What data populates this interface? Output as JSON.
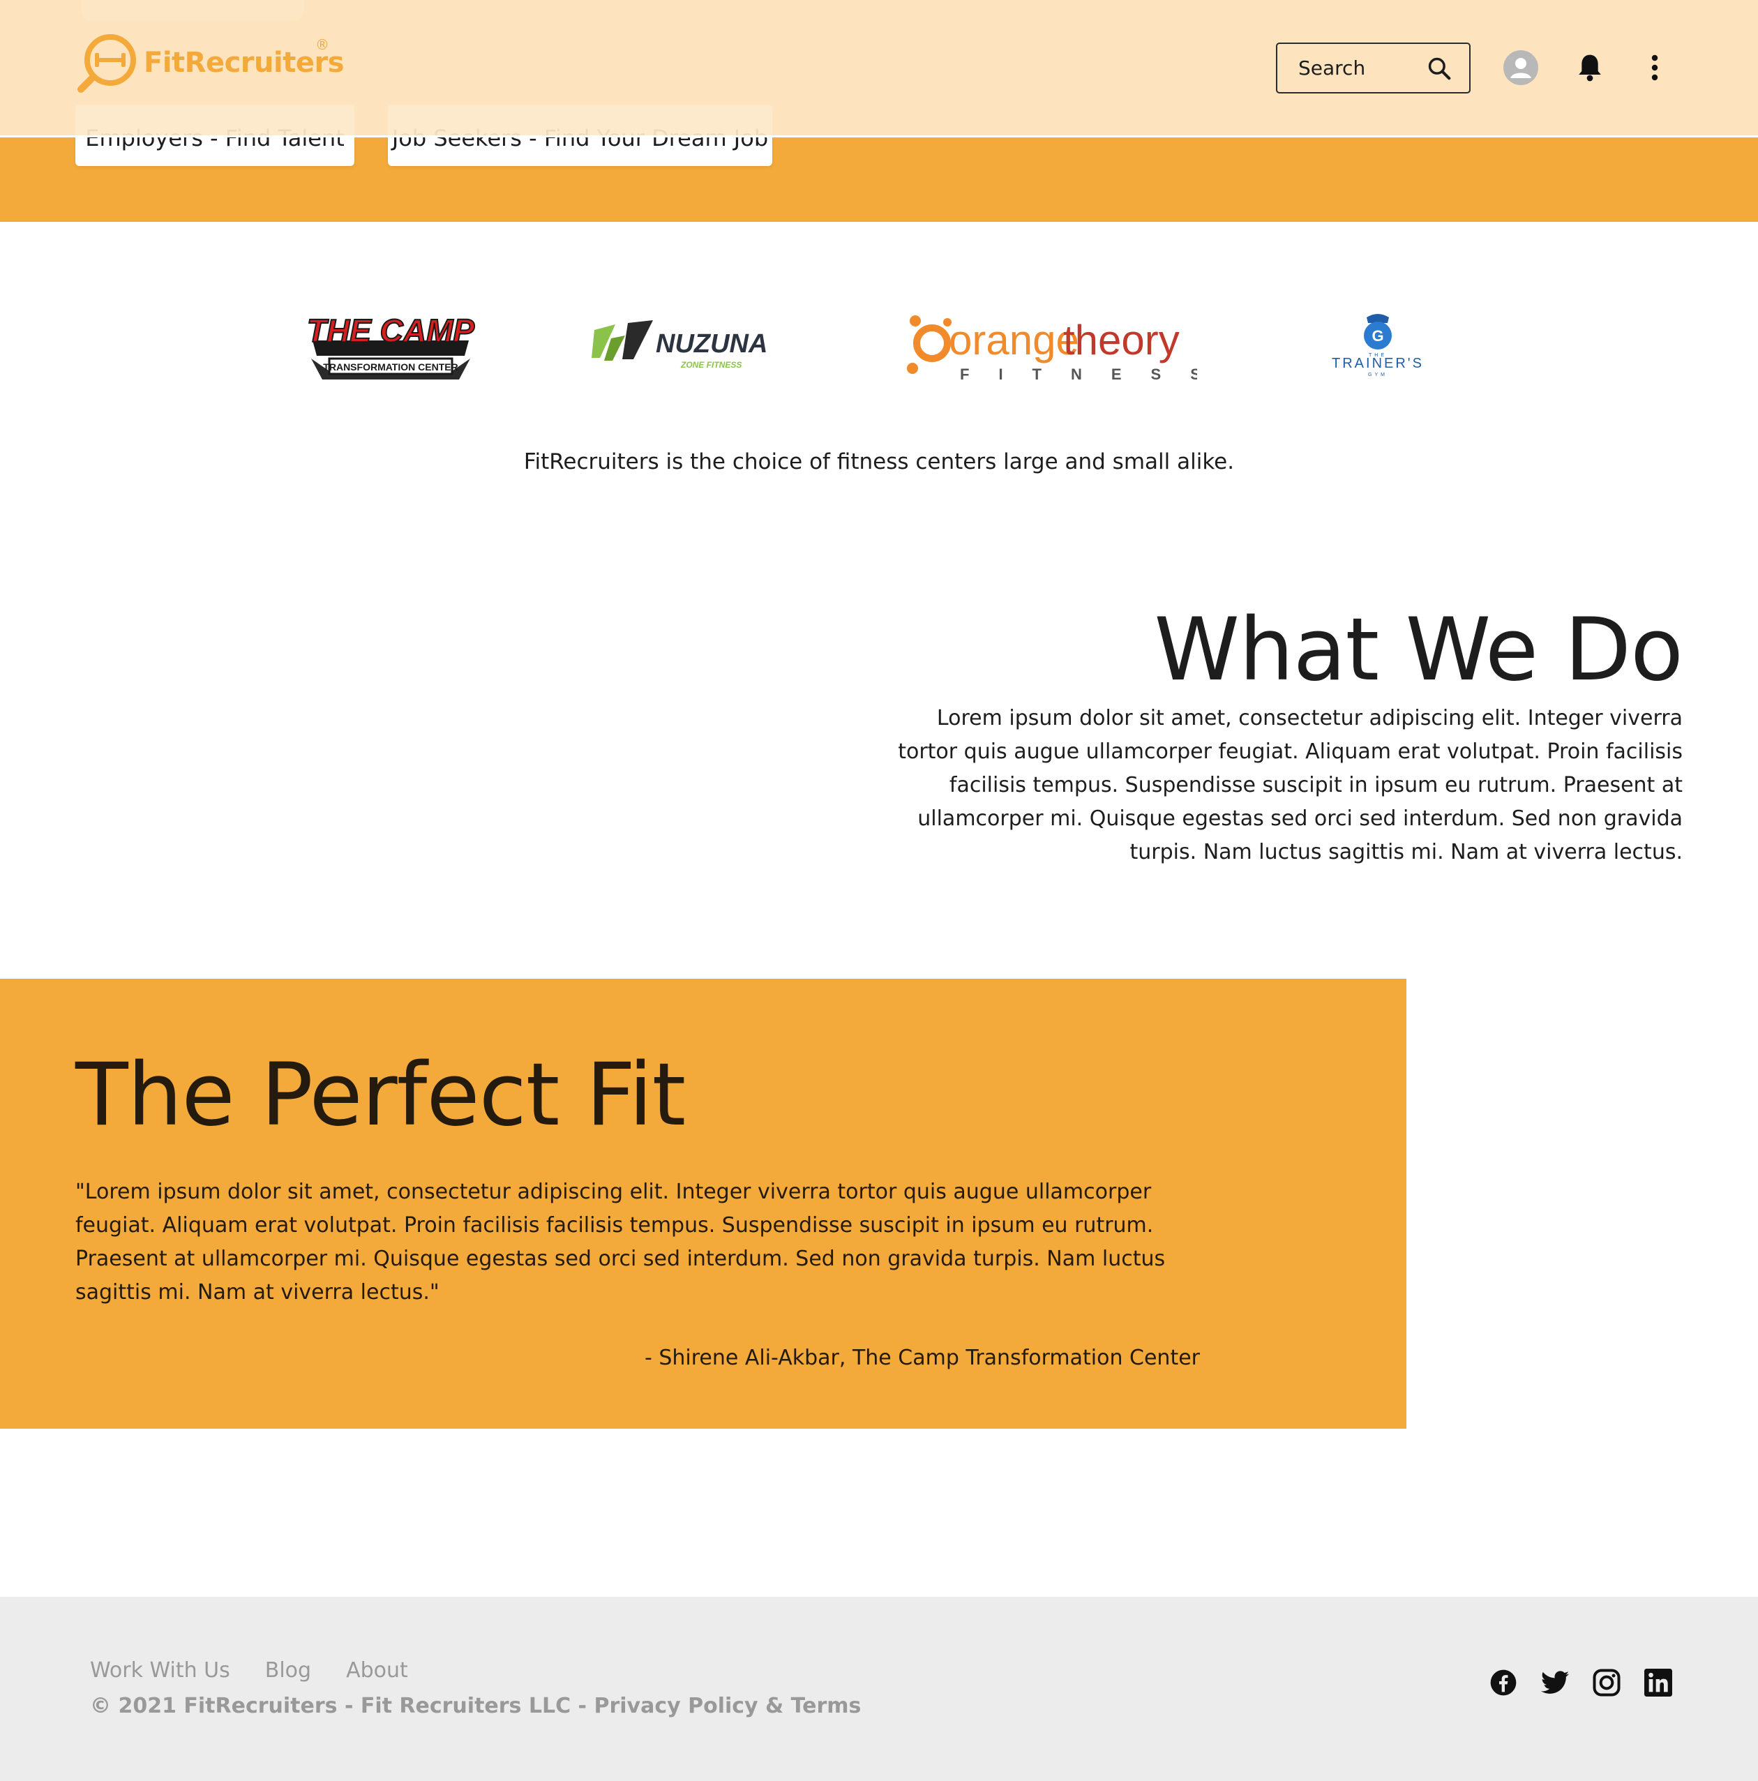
{
  "brand": {
    "name": "FitRecruiters",
    "registered": "®",
    "color": "#f3aa3b"
  },
  "header": {
    "search": {
      "label": "Search",
      "icon": "search-icon"
    },
    "icons": [
      "user-avatar-icon",
      "bell-icon",
      "more-vertical-icon"
    ]
  },
  "hero": {
    "employers_button": "Employers - Find Talent",
    "seekers_button": "Job Seekers - Find Your Dream Job"
  },
  "partners": {
    "logos": [
      {
        "name": "THE CAMP",
        "sub": "TRANSFORMATION CENTER"
      },
      {
        "name": "NUZUNA",
        "sub": "ZONE FITNESS"
      },
      {
        "name_part1": "orange",
        "name_part2": "theory",
        "sub": "FITNESS"
      },
      {
        "name": "TRAINER'S",
        "top": "THE",
        "sub": "GYM"
      }
    ],
    "tagline": "FitRecruiters is the choice of fitness centers large and small alike."
  },
  "what_we_do": {
    "title": "What We Do",
    "body": "Lorem ipsum dolor sit amet, consectetur adipiscing elit. Integer viverra tortor quis augue ullamcorper feugiat. Aliquam erat volutpat. Proin facilisis facilisis tempus. Suspendisse suscipit in ipsum eu rutrum. Praesent at ullamcorper mi. Quisque egestas sed orci sed interdum. Sed non gravida turpis. Nam luctus sagittis mi. Nam at viverra lectus."
  },
  "perfect_fit": {
    "title": "The Perfect Fit",
    "quote": "\"Lorem ipsum dolor sit amet, consectetur adipiscing elit. Integer viverra tortor quis augue ullamcorper feugiat. Aliquam erat volutpat. Proin facilisis facilisis tempus. Suspendisse suscipit in ipsum eu rutrum. Praesent at ullamcorper mi. Quisque egestas sed orci sed interdum. Sed non gravida turpis. Nam luctus sagittis mi. Nam at viverra lectus.\"",
    "author": "- Shirene Ali-Akbar, The Camp Transformation Center"
  },
  "footer": {
    "links": [
      "Work With Us",
      "Blog",
      "About"
    ],
    "copyright": "© 2021 FitRecruiters - Fit Recruiters LLC - ",
    "privacy": "Privacy Policy",
    "amp": " & ",
    "terms": "Terms",
    "socials": [
      "facebook-icon",
      "twitter-icon",
      "instagram-icon",
      "linkedin-icon"
    ]
  }
}
